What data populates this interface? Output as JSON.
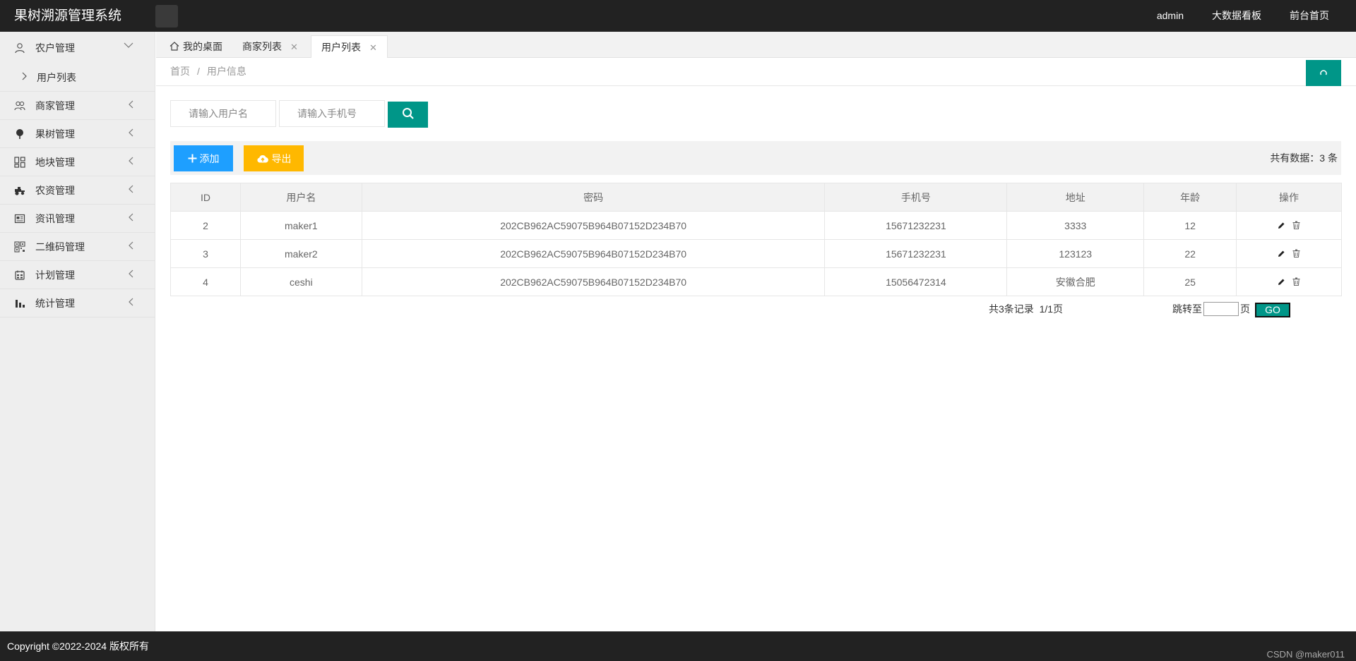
{
  "header": {
    "title": "果树溯源管理系统",
    "nav": [
      "admin",
      "大数据看板",
      "前台首页"
    ]
  },
  "sidebar": {
    "items": [
      {
        "label": "农户管理",
        "icon": "user-icon",
        "open": true
      },
      {
        "label": "商家管理",
        "icon": "users-icon"
      },
      {
        "label": "果树管理",
        "icon": "tree-icon"
      },
      {
        "label": "地块管理",
        "icon": "grid-icon"
      },
      {
        "label": "农资管理",
        "icon": "tractor-icon"
      },
      {
        "label": "资讯管理",
        "icon": "news-icon"
      },
      {
        "label": "二维码管理",
        "icon": "qrcode-icon"
      },
      {
        "label": "计划管理",
        "icon": "plan-icon"
      },
      {
        "label": "统计管理",
        "icon": "bar-chart-icon"
      }
    ],
    "sub_item": "用户列表"
  },
  "tabs": [
    "我的桌面",
    "商家列表",
    "用户列表"
  ],
  "breadcrumb": {
    "home": "首页",
    "sep": "/",
    "current": "用户信息"
  },
  "search": {
    "username_placeholder": "请输入用户名",
    "phone_placeholder": "请输入手机号"
  },
  "toolbar": {
    "add": "添加",
    "export": "导出",
    "total": "共有数据：3 条"
  },
  "table": {
    "columns": [
      "ID",
      "用户名",
      "密码",
      "手机号",
      "地址",
      "年龄",
      "操作"
    ],
    "rows": [
      [
        "2",
        "maker1",
        "202CB962AC59075B964B07152D234B70",
        "15671232231",
        "3333",
        "12"
      ],
      [
        "3",
        "maker2",
        "202CB962AC59075B964B07152D234B70",
        "15671232231",
        "123123",
        "22"
      ],
      [
        "4",
        "ceshi",
        "202CB962AC59075B964B07152D234B70",
        "15056472314",
        "安徽合肥",
        "25"
      ]
    ]
  },
  "pagination": {
    "info": "共3条记录  1/1页",
    "jump_label": "跳转至",
    "page_unit": "页",
    "go": "GO"
  },
  "footer": {
    "copyright": "Copyright ©2022-2024 版权所有",
    "watermark": "CSDN @maker011"
  },
  "colors": {
    "primary": "#009688",
    "blue": "#1e9fff",
    "orange": "#ffb800",
    "dark": "#222222"
  }
}
